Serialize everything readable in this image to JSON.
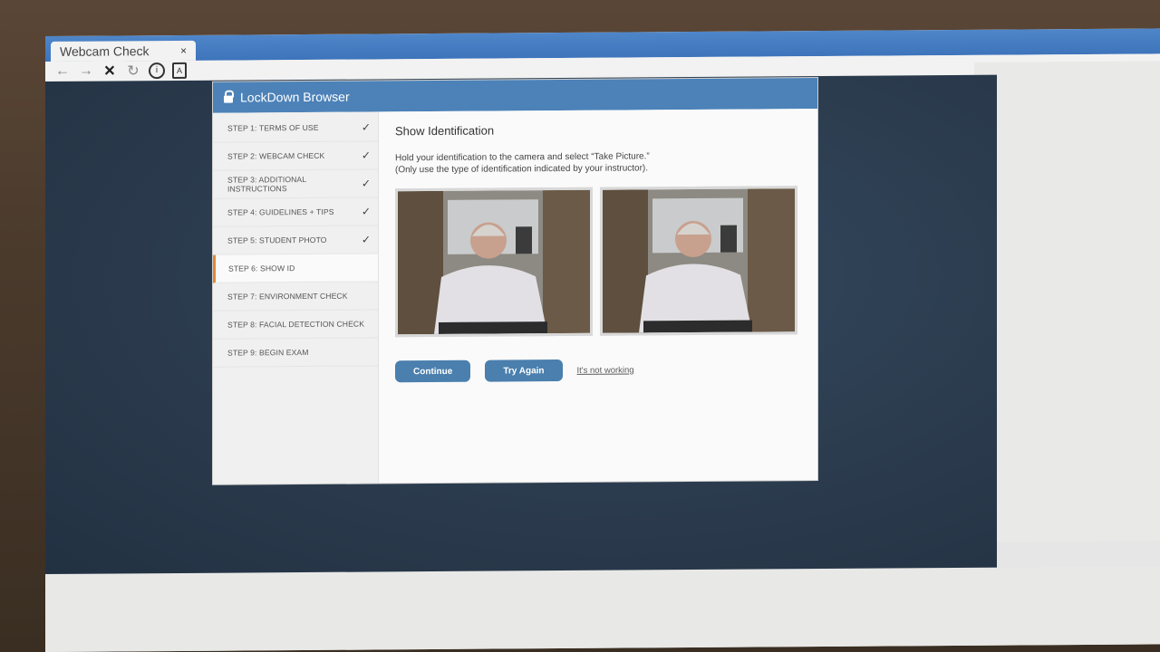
{
  "browser": {
    "tab_title": "Webcam Check",
    "tab_close": "×",
    "back_icon": "←",
    "forward_icon": "→",
    "stop_icon": "✕",
    "reload_icon": "↻",
    "info_icon": "i",
    "doc_icon": "A"
  },
  "window": {
    "title": "LockDown Browser"
  },
  "steps": [
    {
      "label": "STEP 1: TERMS OF USE",
      "done": true
    },
    {
      "label": "STEP 2: WEBCAM CHECK",
      "done": true
    },
    {
      "label": "STEP 3: ADDITIONAL INSTRUCTIONS",
      "done": true
    },
    {
      "label": "STEP 4: GUIDELINES + TIPS",
      "done": true
    },
    {
      "label": "STEP 5: STUDENT PHOTO",
      "done": true
    },
    {
      "label": "STEP 6: SHOW ID",
      "done": false
    },
    {
      "label": "STEP 7: ENVIRONMENT CHECK",
      "done": false
    },
    {
      "label": "STEP 8: FACIAL DETECTION CHECK",
      "done": false
    },
    {
      "label": "STEP 9: BEGIN EXAM",
      "done": false
    }
  ],
  "check_glyph": "✓",
  "main": {
    "heading": "Show Identification",
    "instruction_1": "Hold your identification to the camera and select “Take Picture.”",
    "instruction_2": "(Only use the type of identification indicated by your instructor).",
    "continue_label": "Continue",
    "try_again_label": "Try Again",
    "not_working_label": "It's not working"
  },
  "colors": {
    "title_bar": "#4c82b8",
    "button": "#4a7fae",
    "active_step_marker": "#e0883a"
  }
}
